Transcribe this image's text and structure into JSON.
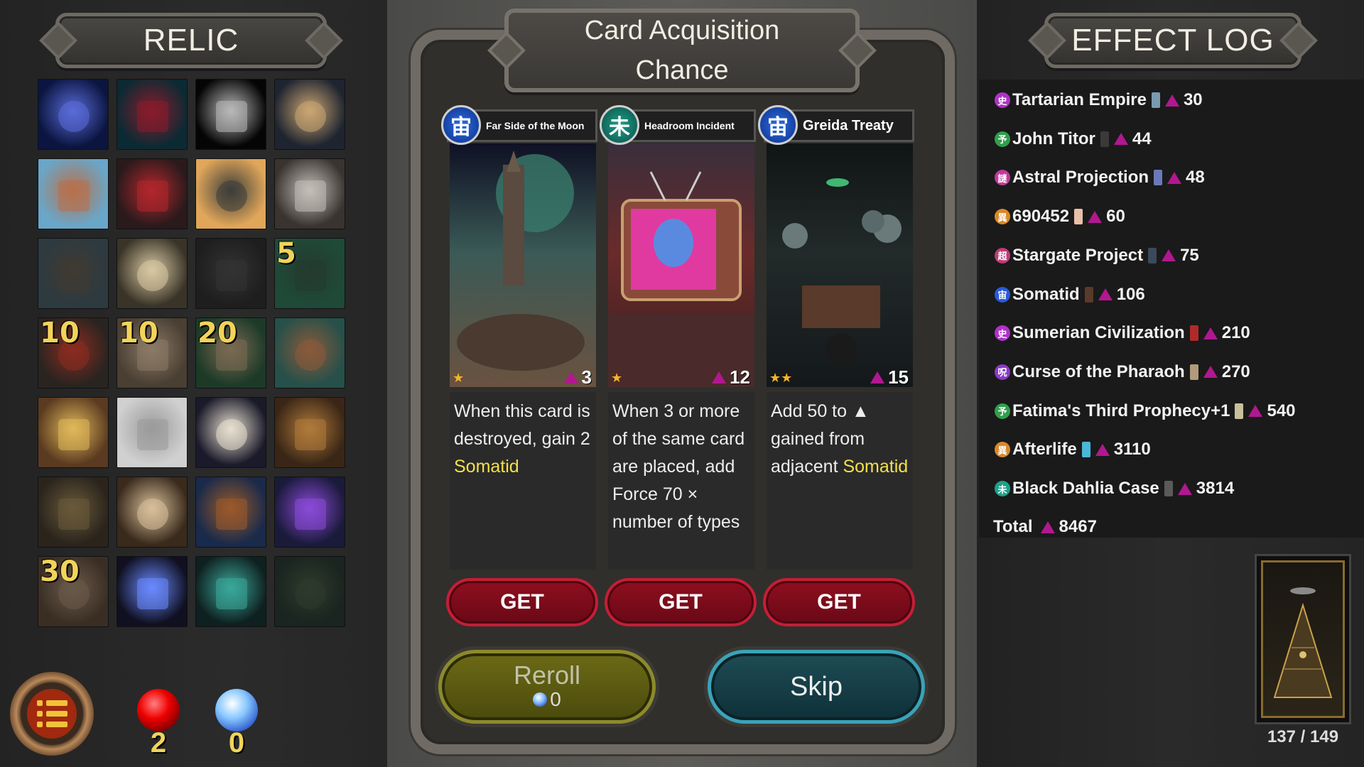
{
  "relic_panel": {
    "title": "RELIC",
    "relics": [
      {
        "name": "tesla-coil-relic",
        "count": "",
        "c1": "#0b1540",
        "c2": "#5a6bd8"
      },
      {
        "name": "red-lamp-relic",
        "count": "",
        "c1": "#0c2a33",
        "c2": "#8a1b2c"
      },
      {
        "name": "bloody-knife-relic",
        "count": "",
        "c1": "#050505",
        "c2": "#b9b9b9"
      },
      {
        "name": "serpent-relic",
        "count": "",
        "c1": "#1e2430",
        "c2": "#caa672"
      },
      {
        "name": "crater-relic",
        "count": "",
        "c1": "#6aa6c8",
        "c2": "#b8704a"
      },
      {
        "name": "mooon-rock-relic",
        "count": "",
        "c1": "#2a1a1c",
        "c2": "#b3272c"
      },
      {
        "name": "ruins-relic",
        "count": "",
        "c1": "#e0a65a",
        "c2": "#3c3e3a"
      },
      {
        "name": "altar-relic",
        "count": "",
        "c1": "#3a3430",
        "c2": "#c3c0b8"
      },
      {
        "name": "vhs-tape-relic",
        "count": "",
        "c1": "#2d3a40",
        "c2": "#3f3a33"
      },
      {
        "name": "parchment-relic",
        "count": "",
        "c1": "#3a3428",
        "c2": "#d8c9a3"
      },
      {
        "name": "red-button-relic",
        "count": "",
        "c1": "#1e1e1e",
        "c2": "#333"
      },
      {
        "name": "severed-relic",
        "count": "5",
        "c1": "#1f4a38",
        "c2": "#243a30"
      },
      {
        "name": "radio-relic",
        "count": "10",
        "c1": "#2a2420",
        "c2": "#8a2c20"
      },
      {
        "name": "stone-disk-relic",
        "count": "10",
        "c1": "#4a3f33",
        "c2": "#8a7a66"
      },
      {
        "name": "boulder-relic",
        "count": "20",
        "c1": "#1d3a28",
        "c2": "#7a6a52"
      },
      {
        "name": "banner-relic",
        "count": "",
        "c1": "#26504a",
        "c2": "#8a5a3a"
      },
      {
        "name": "frog-box-relic",
        "count": "",
        "c1": "#5a3a20",
        "c2": "#e0b85a"
      },
      {
        "name": "metro-ticket-relic",
        "count": "",
        "c1": "#d0d0d0",
        "c2": "#9a9a9a"
      },
      {
        "name": "girl-relic",
        "count": "",
        "c1": "#1a1a2a",
        "c2": "#e8e0d0"
      },
      {
        "name": "wooden-box-relic",
        "count": "",
        "c1": "#3a2616",
        "c2": "#b07a3a"
      },
      {
        "name": "keyboard-relic",
        "count": "",
        "c1": "#2a241c",
        "c2": "#6a5a3a"
      },
      {
        "name": "scroll-relic",
        "count": "",
        "c1": "#3a2a1c",
        "c2": "#d8c09a"
      },
      {
        "name": "cabinet-relic",
        "count": "",
        "c1": "#1a2a4a",
        "c2": "#9a5a2a"
      },
      {
        "name": "vortex-relic",
        "count": "",
        "c1": "#1a1a3a",
        "c2": "#8a4ad8"
      },
      {
        "name": "camera-relic",
        "count": "30",
        "c1": "#3a2e24",
        "c2": "#6a5a4a"
      },
      {
        "name": "lightning-orb-relic",
        "count": "",
        "c1": "#101020",
        "c2": "#6a8aff"
      },
      {
        "name": "brain-relic",
        "count": "",
        "c1": "#0f2020",
        "c2": "#3aa89a"
      },
      {
        "name": "eye-relic",
        "count": "",
        "c1": "#1a2420",
        "c2": "#2e3a2c"
      }
    ]
  },
  "orbs": {
    "red_count": "2",
    "blue_count": "0"
  },
  "acquisition": {
    "title_line1": "Card Acquisition",
    "title_line2": "Chance",
    "cards": [
      {
        "badge_glyph": "宙",
        "badge_color": "blue",
        "name": "Far Side of the Moon",
        "name_size": "14px",
        "stars": "★",
        "cost": "3",
        "desc_text": "When this card is destroyed, gain 2 ",
        "desc_highlight": "Somatid",
        "art_top": "#0f1024",
        "art_mid": "#3b5a56",
        "art_bottom": "#6a5240"
      },
      {
        "badge_glyph": "未",
        "badge_color": "green",
        "name": "Headroom Incident",
        "name_size": "14px",
        "stars": "★",
        "cost": "12",
        "desc_text": "When 3 or more of the same card are placed, add Force 70 × number of types",
        "desc_highlight": "",
        "art_top": "#3a2e3c",
        "art_mid": "#6a2b2a",
        "art_bottom": "#3a1e1e"
      },
      {
        "badge_glyph": "宙",
        "badge_color": "blue",
        "name": "Greida Treaty",
        "name_size": "20px",
        "stars": "★★",
        "cost": "15",
        "desc_text": "Add 50 to ▲ gained from adjacent ",
        "desc_highlight": "Somatid",
        "art_top": "#101414",
        "art_mid": "#222a2a",
        "art_bottom": "#14181a"
      }
    ],
    "get_label": "GET",
    "reroll_label": "Reroll",
    "reroll_cost": "0",
    "skip_label": "Skip"
  },
  "effect_log": {
    "title": "EFFECT LOG",
    "entries": [
      {
        "icon": "史",
        "icon_color": "#b032c8",
        "name": "Tartarian Empire",
        "value": "30",
        "thumb": "#7a9ab0"
      },
      {
        "icon": "予",
        "icon_color": "#2fa04a",
        "name": "John Titor",
        "value": "44",
        "thumb": "#3a3a3a"
      },
      {
        "icon": "謎",
        "icon_color": "#c03a9a",
        "name": "Astral Projection",
        "value": "48",
        "thumb": "#6a7ab8"
      },
      {
        "icon": "異",
        "icon_color": "#d8892a",
        "name": "690452",
        "value": "60",
        "thumb": "#e8c0a8"
      },
      {
        "icon": "超",
        "icon_color": "#c03a7a",
        "name": "Stargate Project",
        "value": "75",
        "thumb": "#3a4a5a"
      },
      {
        "icon": "宙",
        "icon_color": "#2a5ad8",
        "name": "Somatid",
        "value": "106",
        "thumb": "#5a3a2a"
      },
      {
        "icon": "史",
        "icon_color": "#b032c8",
        "name": "Sumerian Civilization",
        "value": "210",
        "thumb": "#b02a2a"
      },
      {
        "icon": "呪",
        "icon_color": "#8a3ac8",
        "name": "Curse of the Pharaoh",
        "value": "270",
        "thumb": "#b09a7a"
      },
      {
        "icon": "予",
        "icon_color": "#2fa04a",
        "name": "Fatima's Third Prophecy+1",
        "value": "540",
        "thumb": "#c8c09a"
      },
      {
        "icon": "異",
        "icon_color": "#d8892a",
        "name": "Afterlife",
        "value": "3110",
        "thumb": "#4ab8d8"
      },
      {
        "icon": "未",
        "icon_color": "#1fa08a",
        "name": "Black Dahlia Case",
        "value": "3814",
        "thumb": "#5a5a5a"
      }
    ],
    "total_label": "Total",
    "total_value": "8467"
  },
  "deck": {
    "count": "137 / 149"
  },
  "colors": {
    "force_icon": "#b1188f",
    "highlight": "#f3e04a",
    "get_button": "#8e0f1f"
  }
}
